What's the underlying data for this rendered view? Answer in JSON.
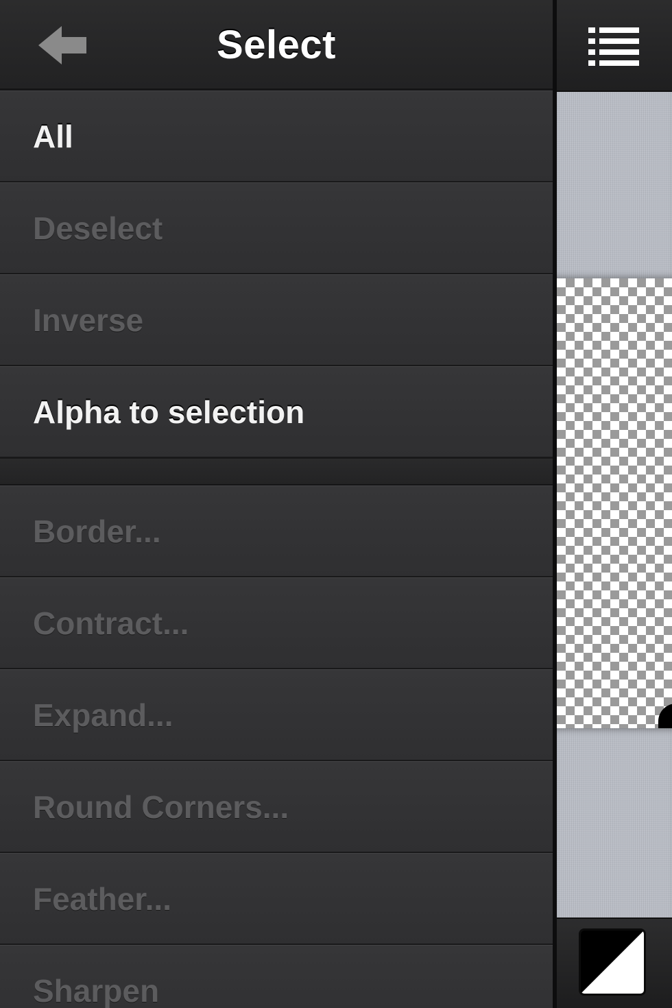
{
  "header": {
    "title": "Select"
  },
  "menu": {
    "items": [
      {
        "label": "All",
        "enabled": true
      },
      {
        "label": "Deselect",
        "enabled": false
      },
      {
        "label": "Inverse",
        "enabled": false
      },
      {
        "label": "Alpha to selection",
        "enabled": true
      }
    ],
    "modify_items": [
      {
        "label": "Border...",
        "enabled": false
      },
      {
        "label": "Contract...",
        "enabled": false
      },
      {
        "label": "Expand...",
        "enabled": false
      },
      {
        "label": "Round Corners...",
        "enabled": false
      },
      {
        "label": "Feather...",
        "enabled": false
      },
      {
        "label": "Sharpen",
        "enabled": false
      }
    ]
  },
  "icons": {
    "back": "arrow-left-icon",
    "list_menu": "list-menu-icon",
    "color_swatch": "color-swatch-icon"
  },
  "colors": {
    "foreground": "#000000",
    "background": "#ffffff"
  }
}
